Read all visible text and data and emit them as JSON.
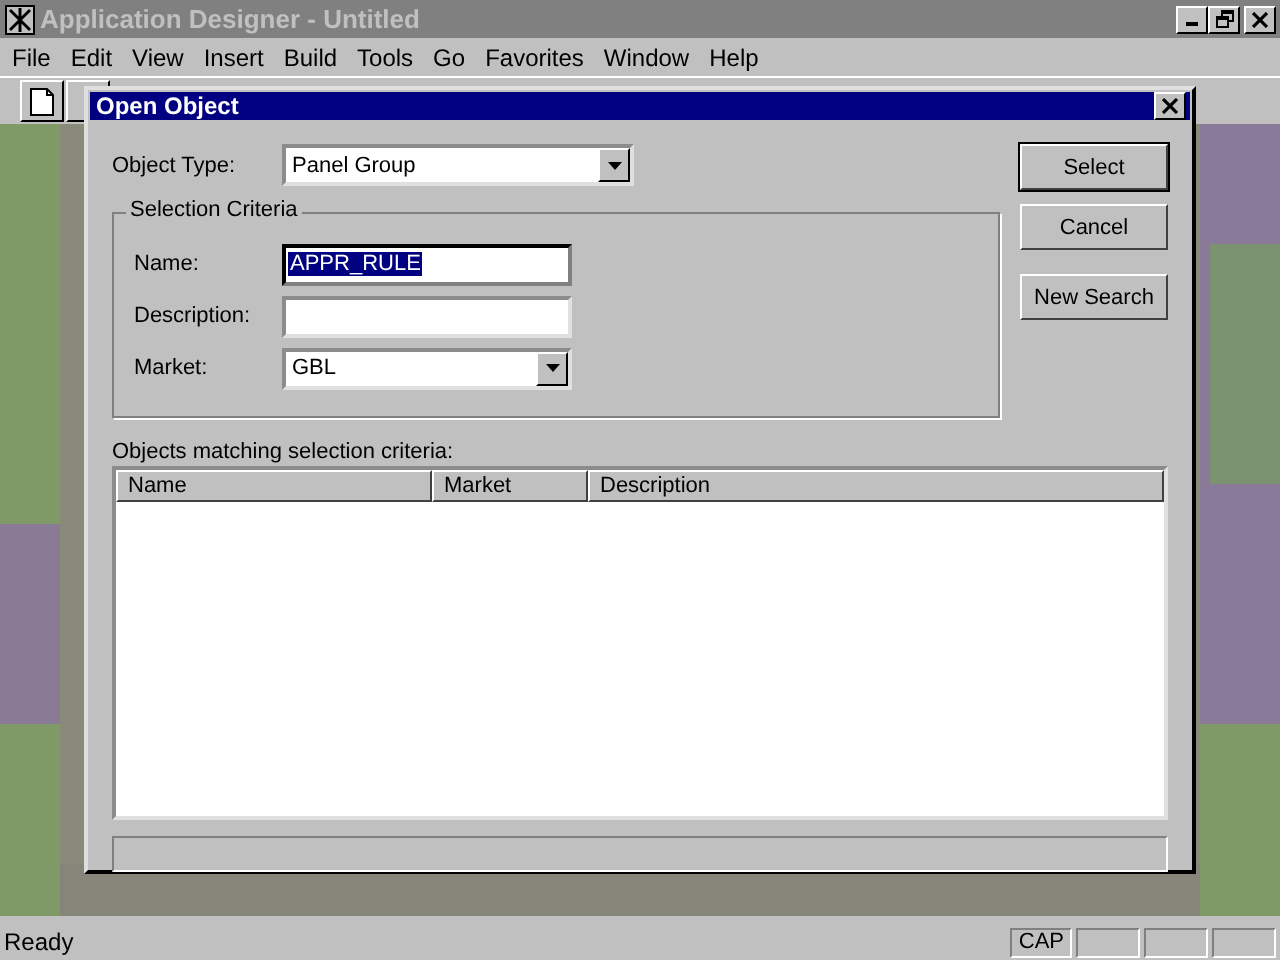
{
  "window": {
    "title": "Application Designer - Untitled"
  },
  "menu": [
    "File",
    "Edit",
    "View",
    "Insert",
    "Build",
    "Tools",
    "Go",
    "Favorites",
    "Window",
    "Help"
  ],
  "dialog": {
    "title": "Open Object",
    "object_type": {
      "label": "Object Type:",
      "value": "Panel Group"
    },
    "criteria": {
      "title": "Selection Criteria",
      "fields": [
        {
          "kind": "text",
          "label": "Name:",
          "value": "APPR_RULE",
          "selected": true
        },
        {
          "kind": "text",
          "label": "Description:",
          "selected": false
        },
        {
          "kind": "combo",
          "label": "Market:",
          "value": "GBL",
          "selected": false
        }
      ]
    },
    "buttons": [
      {
        "label": "Select",
        "default": true
      },
      {
        "label": "Cancel",
        "default": false
      },
      {
        "label": "New Search",
        "default": false
      }
    ],
    "results": {
      "label": "Objects matching selection criteria:",
      "columns": [
        "Name",
        "Market",
        "Description"
      ]
    }
  },
  "status_bar": {
    "text": "Ready",
    "indicators": [
      "CAP"
    ]
  }
}
